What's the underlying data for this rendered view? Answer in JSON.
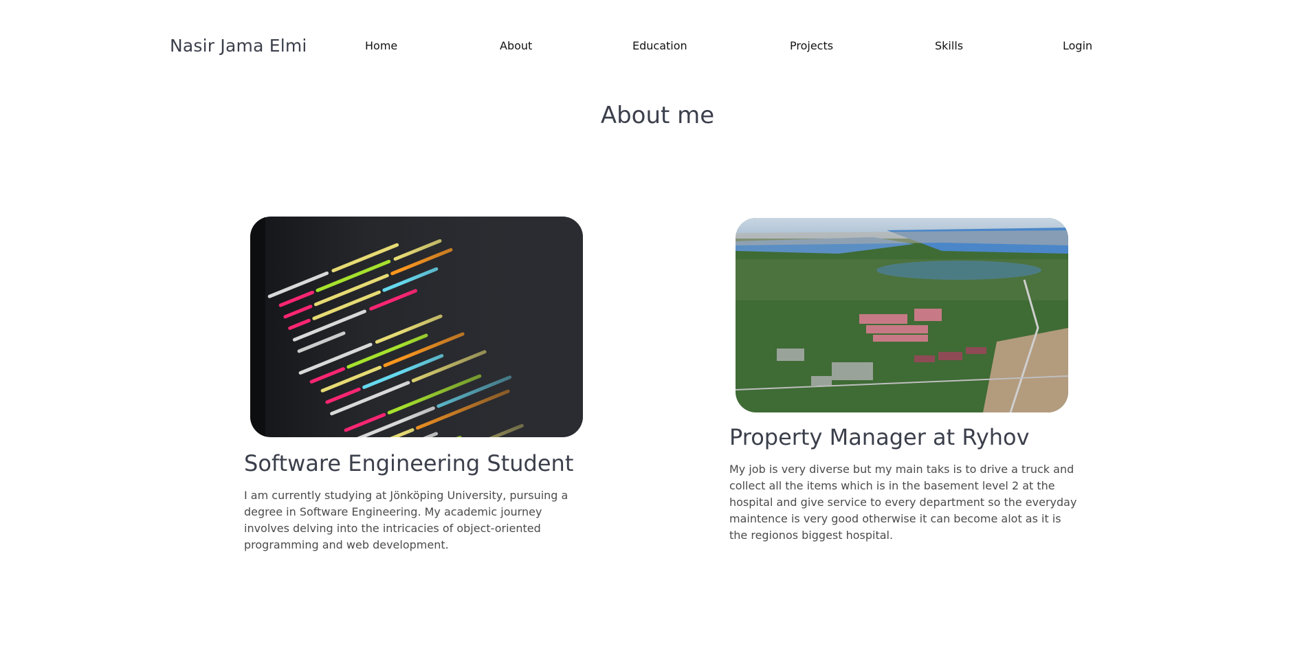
{
  "header": {
    "brand": "Nasir Jama Elmi",
    "nav": [
      {
        "label": "Home"
      },
      {
        "label": "About"
      },
      {
        "label": "Education"
      },
      {
        "label": "Projects"
      },
      {
        "label": "Skills"
      },
      {
        "label": "Login"
      }
    ]
  },
  "about": {
    "title": "About me",
    "cards": [
      {
        "image": "code-screen-image",
        "title": "Software Engineering Student",
        "text": "I am currently studying at Jönköping University, pursuing a degree in Software Engineering. My academic journey involves delving into the intricacies of object-oriented programming and web development."
      },
      {
        "image": "hospital-aerial-image",
        "title": "Property Manager at Ryhov",
        "text": "My job is very diverse but my main taks is to drive a truck and collect all the items which is in the basement level 2 at the hospital and give service to every department so the everyday maintence is very good otherwise it can become alot as it is the regionos biggest hospital."
      }
    ]
  }
}
